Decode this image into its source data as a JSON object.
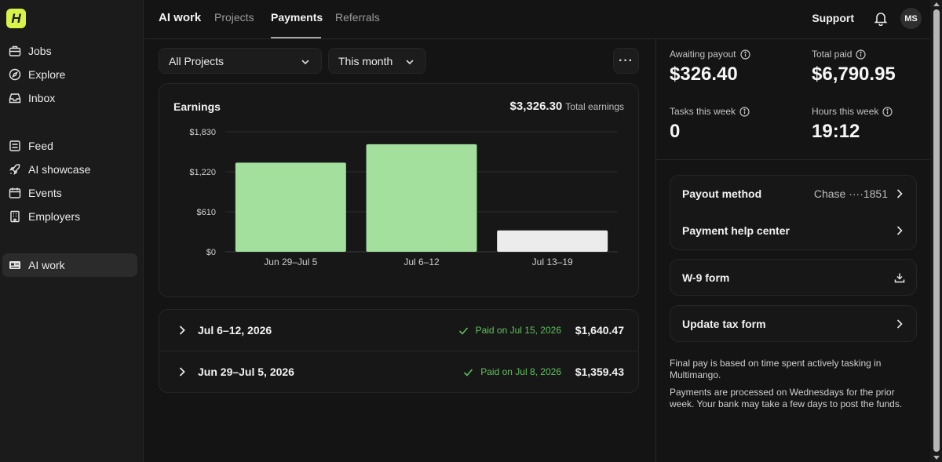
{
  "app": {
    "logo_letter": "H"
  },
  "sidebar": {
    "items": [
      {
        "label": "Jobs",
        "icon": "briefcase-icon"
      },
      {
        "label": "Explore",
        "icon": "compass-icon"
      },
      {
        "label": "Inbox",
        "icon": "inbox-icon"
      },
      {
        "label": "Feed",
        "icon": "feed-icon"
      },
      {
        "label": "AI showcase",
        "icon": "rocket-icon"
      },
      {
        "label": "Events",
        "icon": "calendar-icon"
      },
      {
        "label": "Employers",
        "icon": "building-icon"
      },
      {
        "label": "AI work",
        "icon": "id-card-icon",
        "active": true
      }
    ]
  },
  "header": {
    "section": "AI work",
    "tabs": [
      {
        "label": "Projects"
      },
      {
        "label": "Payments",
        "active": true
      },
      {
        "label": "Referrals"
      }
    ],
    "support_label": "Support",
    "avatar_initials": "MS"
  },
  "filters": {
    "project": "All Projects",
    "period": "This month",
    "more_label": "···"
  },
  "earnings": {
    "title": "Earnings",
    "total_value": "$3,326.30",
    "total_label": "Total earnings"
  },
  "chart_data": {
    "type": "bar",
    "categories": [
      "Jun 29–Jul 5",
      "Jul 6–12",
      "Jul 13–19"
    ],
    "values": [
      1359.43,
      1640.47,
      326.4
    ],
    "y_ticks": [
      0,
      610,
      1220,
      1830
    ],
    "y_tick_labels": [
      "$0",
      "$610",
      "$1,220",
      "$1,830"
    ],
    "ylim": [
      0,
      1830
    ],
    "grid": true,
    "colors": [
      "#a3df9d",
      "#a3df9d",
      "#ececec"
    ]
  },
  "history": [
    {
      "period": "Jul 6–12, 2026",
      "status": "Paid on Jul 15, 2026",
      "amount": "$1,640.47"
    },
    {
      "period": "Jun 29–Jul 5, 2026",
      "status": "Paid on Jul 8, 2026",
      "amount": "$1,359.43"
    }
  ],
  "stats": {
    "awaiting_label": "Awaiting payout",
    "awaiting_value": "$326.40",
    "total_paid_label": "Total paid",
    "total_paid_value": "$6,790.95",
    "tasks_label": "Tasks this week",
    "tasks_value": "0",
    "hours_label": "Hours this week",
    "hours_value": "19:12"
  },
  "payout": {
    "method_label": "Payout method",
    "method_value": "Chase ····1851",
    "help_label": "Payment help center",
    "w9_label": "W-9 form",
    "tax_label": "Update tax form"
  },
  "notes": {
    "note1": "Final pay is based on time spent actively tasking in Multimango.",
    "note2": "Payments are processed on Wednesdays for the prior week. Your bank may take a few days to post the funds."
  },
  "colors": {
    "accent_green": "#5cc25d",
    "bar_green": "#a3df9d",
    "logo": "#d8f34a"
  }
}
